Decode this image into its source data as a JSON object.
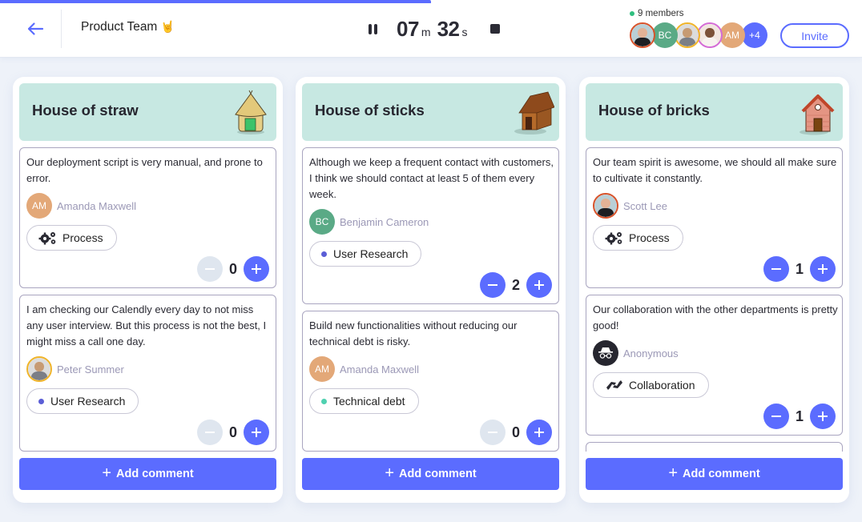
{
  "progress": {
    "percent": 50,
    "color": "#5b6cff"
  },
  "header": {
    "back_label": "Back",
    "team_name": "Product Team",
    "team_emoji": "🤘",
    "timer": {
      "minutes": "07",
      "minutes_unit": "m",
      "seconds": "32",
      "seconds_unit": "s"
    },
    "members_label": "9 members",
    "members": [
      {
        "type": "photo",
        "name": "Scott Lee",
        "ring": "#d8532b"
      },
      {
        "type": "initials",
        "initials": "BC",
        "color": "#5aaa86"
      },
      {
        "type": "photo",
        "name": "Peter Summer",
        "ring": "#f0b429"
      },
      {
        "type": "photo",
        "name": "Member",
        "ring": "#d46bd6"
      },
      {
        "type": "initials",
        "initials": "AM",
        "color": "#e3a878"
      },
      {
        "type": "more",
        "label": "+4",
        "color": "#5b6cff"
      }
    ],
    "invite_label": "Invite"
  },
  "columns": [
    {
      "title": "House of straw",
      "icon": "straw-hut-icon",
      "add_label": "Add comment",
      "cards": [
        {
          "text": "Our deployment script is very manual, and prone to error.",
          "author": "Amanda Maxwell",
          "avatar_initials": "AM",
          "avatar_color": "#e3a878",
          "avatar_type": "initials",
          "tag": "Process",
          "tag_icon": "gears-icon",
          "votes": "0",
          "minus_enabled": false
        },
        {
          "text": "I am checking our Calendly every day to not miss any user interview. But this process is not the best, I might miss a call one day.",
          "author": "Peter Summer",
          "avatar_type": "photo",
          "avatar_ring": "#f0b429",
          "tag": "User Research",
          "tag_dot_color": "#5b5ed6",
          "votes": "0",
          "minus_enabled": false
        }
      ]
    },
    {
      "title": "House of sticks",
      "icon": "wooden-house-icon",
      "add_label": "Add comment",
      "cards": [
        {
          "text": "Although we keep a frequent contact with customers, I think we should contact at least 5 of them every week.",
          "author": "Benjamin Cameron",
          "avatar_initials": "BC",
          "avatar_color": "#5aaa86",
          "avatar_type": "initials",
          "tag": "User Research",
          "tag_dot_color": "#5b5ed6",
          "votes": "2",
          "minus_enabled": true
        },
        {
          "text": "Build new functionalities without reducing our technical debt is risky.",
          "author": "Amanda Maxwell",
          "avatar_initials": "AM",
          "avatar_color": "#e3a878",
          "avatar_type": "initials",
          "tag": "Technical debt",
          "tag_dot_color": "#4fd1b0",
          "votes": "0",
          "minus_enabled": false
        }
      ]
    },
    {
      "title": "House of bricks",
      "icon": "brick-house-icon",
      "add_label": "Add comment",
      "cards": [
        {
          "text": "Our team spirit is awesome, we should all make sure to cultivate it constantly.",
          "author": "Scott Lee",
          "avatar_type": "photo",
          "avatar_ring": "#d8532b",
          "tag": "Process",
          "tag_icon": "gears-icon",
          "votes": "1",
          "minus_enabled": true
        },
        {
          "text": "Our collaboration with the other departments is pretty good!",
          "author": "Anonymous",
          "avatar_type": "anonymous",
          "tag": "Collaboration",
          "tag_icon": "handshake-icon",
          "votes": "1",
          "minus_enabled": true
        }
      ]
    }
  ]
}
